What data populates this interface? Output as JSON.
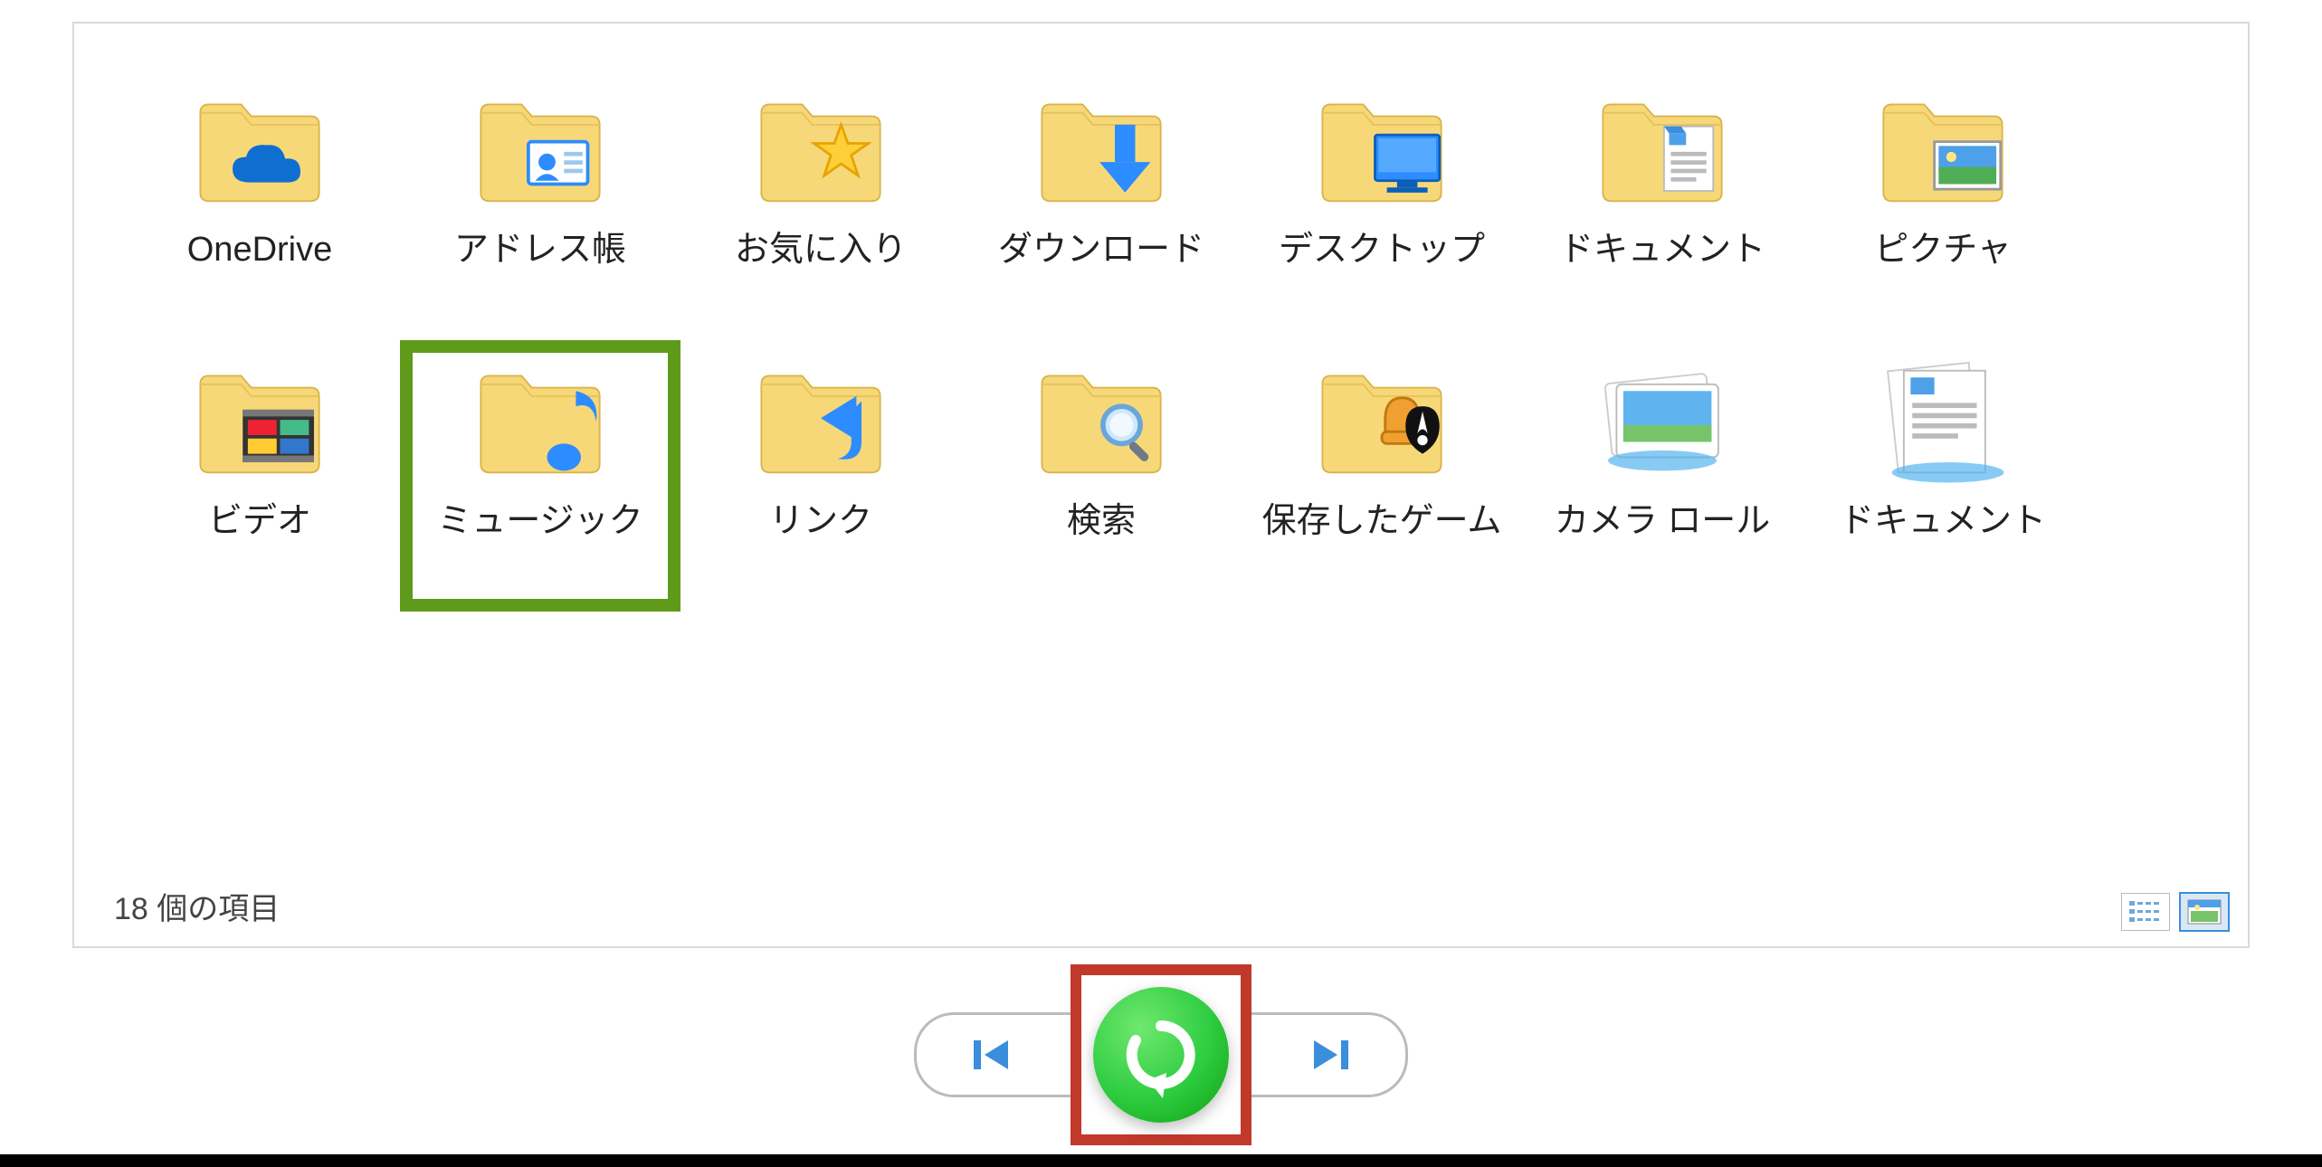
{
  "colors": {
    "highlight_green": "#5f9a1b",
    "highlight_red": "#c0392b",
    "folder_fill": "#f7d879",
    "folder_tab": "#e8c14e",
    "accent_blue": "#2d8cff"
  },
  "items": [
    {
      "id": "onedrive",
      "label": "OneDrive",
      "icon": "onedrive-folder",
      "highlighted": false
    },
    {
      "id": "contacts",
      "label": "アドレス帳",
      "icon": "contacts-folder",
      "highlighted": false
    },
    {
      "id": "favorites",
      "label": "お気に入り",
      "icon": "favorites-folder",
      "highlighted": false
    },
    {
      "id": "downloads",
      "label": "ダウンロード",
      "icon": "downloads-folder",
      "highlighted": false
    },
    {
      "id": "desktop",
      "label": "デスクトップ",
      "icon": "desktop-folder",
      "highlighted": false
    },
    {
      "id": "documents",
      "label": "ドキュメント",
      "icon": "documents-folder",
      "highlighted": false
    },
    {
      "id": "pictures",
      "label": "ピクチャ",
      "icon": "pictures-folder",
      "highlighted": false
    },
    {
      "id": "videos",
      "label": "ビデオ",
      "icon": "videos-folder",
      "highlighted": false
    },
    {
      "id": "music",
      "label": "ミュージック",
      "icon": "music-folder",
      "highlighted": true
    },
    {
      "id": "links",
      "label": "リンク",
      "icon": "links-folder",
      "highlighted": false
    },
    {
      "id": "searches",
      "label": "検索",
      "icon": "searches-folder",
      "highlighted": false
    },
    {
      "id": "savedgames",
      "label": "保存したゲーム",
      "icon": "savedgames-folder",
      "highlighted": false
    },
    {
      "id": "cameraroll",
      "label": "カメラ ロール",
      "icon": "cameraroll-stack",
      "highlighted": false
    },
    {
      "id": "documents2",
      "label": "ドキュメント",
      "icon": "documents-stack",
      "highlighted": false
    }
  ],
  "status_text": "18 個の項目",
  "view": {
    "details_selected": false,
    "large_icons_selected": true
  },
  "nav": {
    "previous": "previous-version",
    "restore": "restore",
    "next": "next-version",
    "restore_highlighted": true
  }
}
